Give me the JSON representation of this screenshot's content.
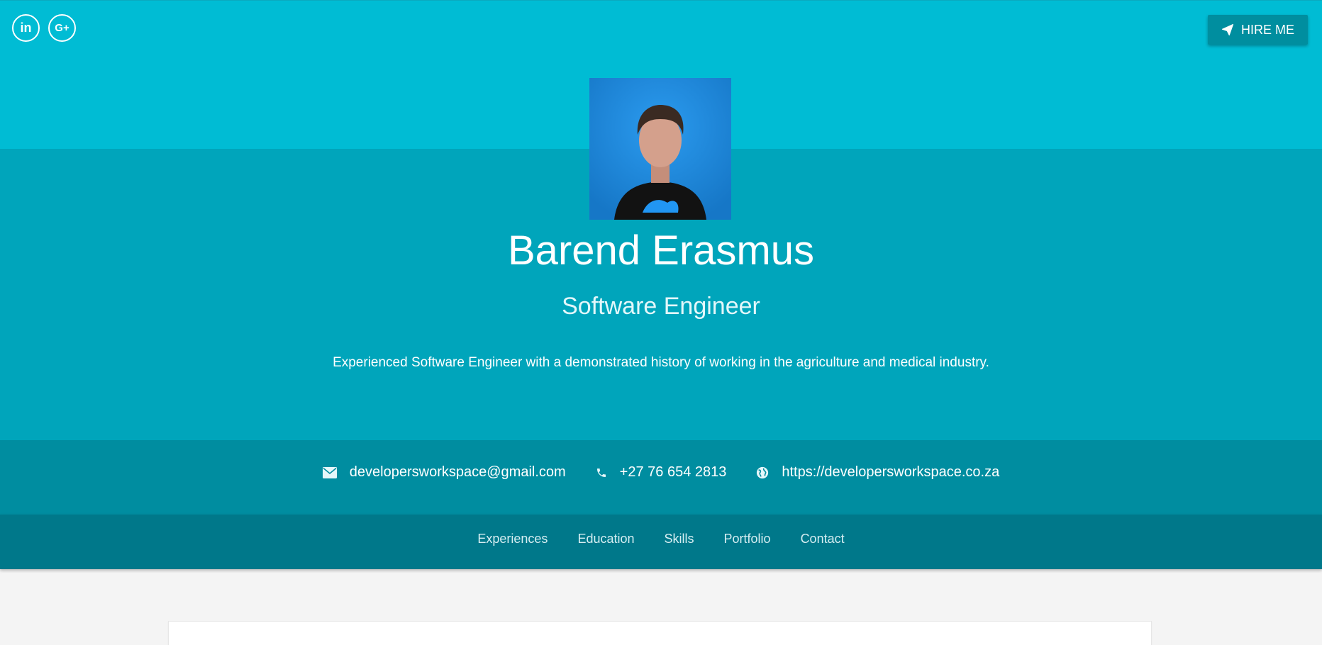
{
  "header": {
    "social": [
      {
        "icon": "linkedin-icon",
        "glyph": "in"
      },
      {
        "icon": "google-plus-icon",
        "glyph": "G+"
      }
    ],
    "hire_label": "HIRE ME"
  },
  "profile": {
    "name": "Barend Erasmus",
    "role": "Software Engineer",
    "summary": "Experienced Software Engineer with a demonstrated history of working in the agriculture and medical industry."
  },
  "contact": {
    "email": "developersworkspace@gmail.com",
    "phone": "+27 76 654 2813",
    "website": "https://developersworkspace.co.za"
  },
  "nav": {
    "items": [
      "Experiences",
      "Education",
      "Skills",
      "Portfolio",
      "Contact"
    ]
  },
  "colors": {
    "top_band": "#00bcd4",
    "mid_band": "#00a5bb",
    "contact_band": "#008da0",
    "nav_band": "#00788a",
    "page_bg": "#f4f4f4"
  }
}
